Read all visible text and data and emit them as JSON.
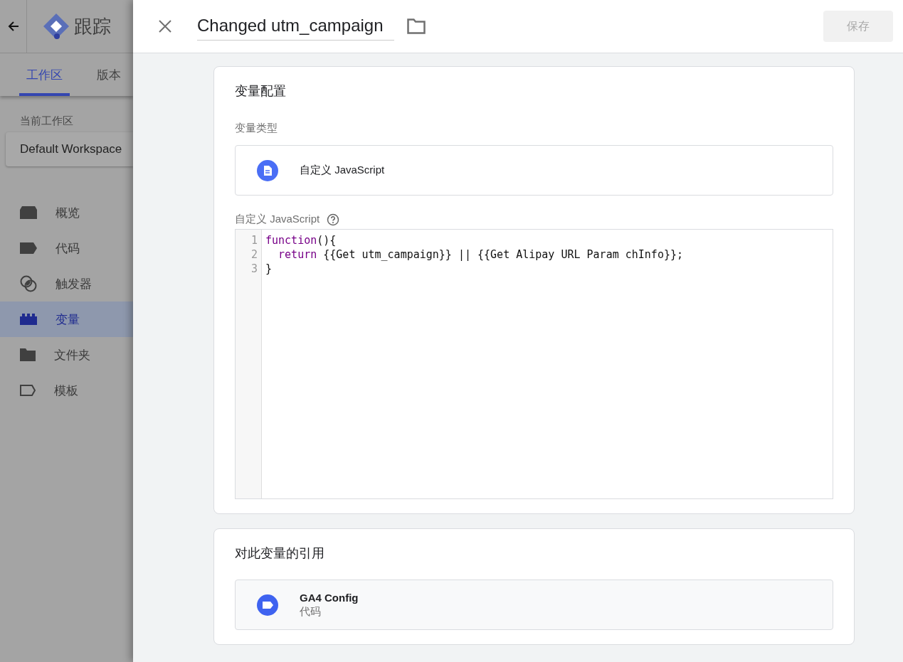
{
  "background_page": {
    "title": "跟踪",
    "tabs": [
      {
        "label": "工作区",
        "selected": true
      },
      {
        "label": "版本",
        "selected": false
      }
    ],
    "workspace_label": "当前工作区",
    "workspace": "Default Workspace",
    "nav": [
      {
        "label": "概览",
        "kind": "overview",
        "selected": false
      },
      {
        "label": "代码",
        "kind": "tag",
        "selected": false
      },
      {
        "label": "触发器",
        "kind": "trigger",
        "selected": false
      },
      {
        "label": "变量",
        "kind": "variable",
        "selected": true
      },
      {
        "label": "文件夹",
        "kind": "folder",
        "selected": false
      },
      {
        "label": "模板",
        "kind": "template",
        "selected": false
      }
    ]
  },
  "drawer": {
    "title": "Changed utm_campaign",
    "save_button": {
      "label": "保存",
      "disabled": true
    },
    "config": {
      "heading": "变量配置",
      "type_label": "变量类型",
      "type": "自定义 JavaScript",
      "code_label": "自定义 JavaScript",
      "code": [
        {
          "number": "1",
          "tokens": [
            {
              "kind": "keyword",
              "text": "function"
            },
            {
              "kind": "plain",
              "text": "(){"
            }
          ]
        },
        {
          "number": "2",
          "tokens": [
            {
              "kind": "keyword",
              "text": "  return"
            },
            {
              "kind": "plain",
              "text": " {{Get utm_campaign}} || {{Get Alipay URL Param chInfo}};"
            }
          ]
        },
        {
          "number": "3",
          "tokens": [
            {
              "kind": "plain",
              "text": "}"
            }
          ]
        }
      ]
    },
    "references": {
      "heading": "对此变量的引用",
      "items": [
        {
          "name": "GA4 Config",
          "type": "代码"
        }
      ]
    }
  }
}
